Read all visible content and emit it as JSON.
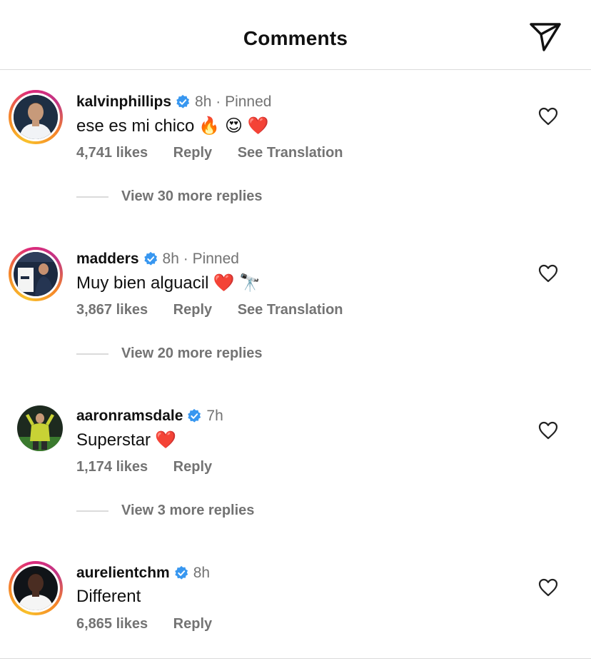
{
  "header": {
    "title": "Comments",
    "send_icon": "paper-plane-icon"
  },
  "comments": [
    {
      "username": "kalvinphillips",
      "verified": true,
      "time": "8h · Pinned",
      "text": "ese es mi chico",
      "emojis": "🔥 😍 ❤️",
      "likes": "4,741 likes",
      "reply": "Reply",
      "translate": "See Translation",
      "more_replies": "View 30 more replies",
      "story_ring": true
    },
    {
      "username": "madders",
      "verified": true,
      "time": "8h · Pinned",
      "text": "Muy bien alguacil",
      "emojis": "❤️ 🔭",
      "likes": "3,867 likes",
      "reply": "Reply",
      "translate": "See Translation",
      "more_replies": "View 20 more replies",
      "story_ring": true
    },
    {
      "username": "aaronramsdale",
      "verified": true,
      "time": "7h",
      "text": "Superstar",
      "emojis": "❤️",
      "likes": "1,174 likes",
      "reply": "Reply",
      "more_replies": "View 3 more replies",
      "story_ring": false
    },
    {
      "username": "aurelientchm",
      "verified": true,
      "time": "8h",
      "text": "Different",
      "likes": "6,865 likes",
      "reply": "Reply",
      "story_ring": true
    }
  ],
  "colors": {
    "verified": "#3897f0",
    "secondary_text": "#737373",
    "divider": "#dbdbdb"
  }
}
